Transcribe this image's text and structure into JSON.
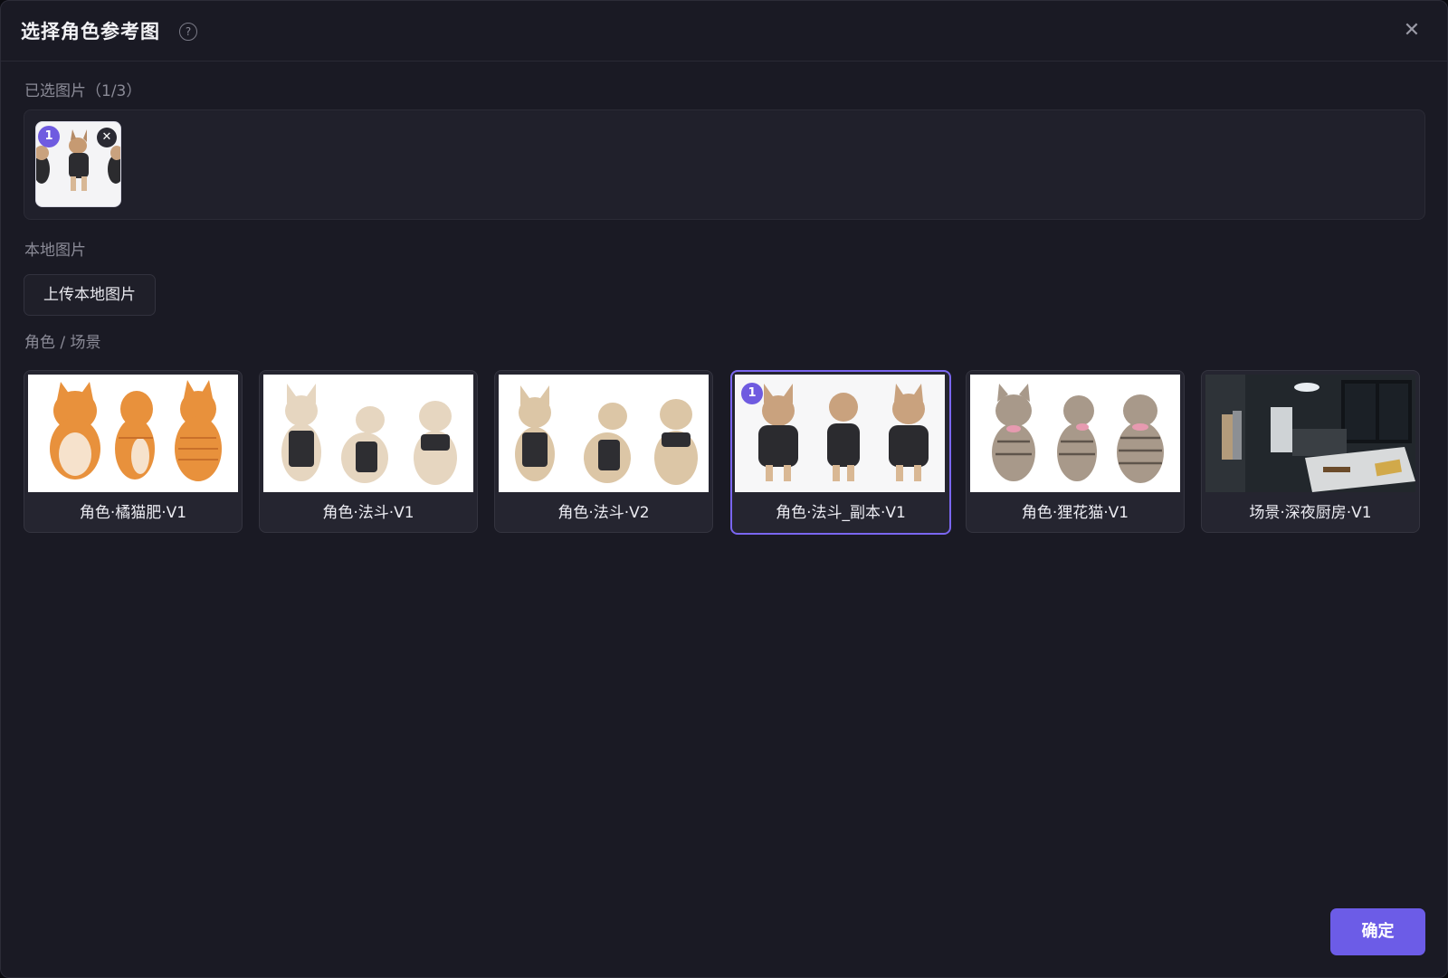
{
  "dialog": {
    "title": "选择角色参考图",
    "help_icon": "question-circle-icon",
    "close_icon": "close-icon",
    "help_glyph": "?",
    "close_glyph": "✕"
  },
  "selected": {
    "label": "已选图片（1/3）",
    "items": [
      {
        "index": "1",
        "remove_glyph": "✕",
        "thumbnail": "french-bulldog-copy-thumbnail"
      }
    ]
  },
  "local": {
    "label": "本地图片",
    "upload_button": "上传本地图片"
  },
  "library": {
    "label": "角色 / 场景",
    "cards": [
      {
        "label": "角色·橘猫肥·V1",
        "selected": false,
        "badge": ""
      },
      {
        "label": "角色·法斗·V1",
        "selected": false,
        "badge": ""
      },
      {
        "label": "角色·法斗·V2",
        "selected": false,
        "badge": ""
      },
      {
        "label": "角色·法斗_副本·V1",
        "selected": true,
        "badge": "1"
      },
      {
        "label": "角色·狸花猫·V1",
        "selected": false,
        "badge": ""
      },
      {
        "label": "场景·深夜厨房·V1",
        "selected": false,
        "badge": ""
      }
    ]
  },
  "footer": {
    "confirm_button": "确定"
  },
  "colors": {
    "accent": "#6c5ce7",
    "background": "#1a1a24",
    "selected_border": "#7a66f0"
  }
}
